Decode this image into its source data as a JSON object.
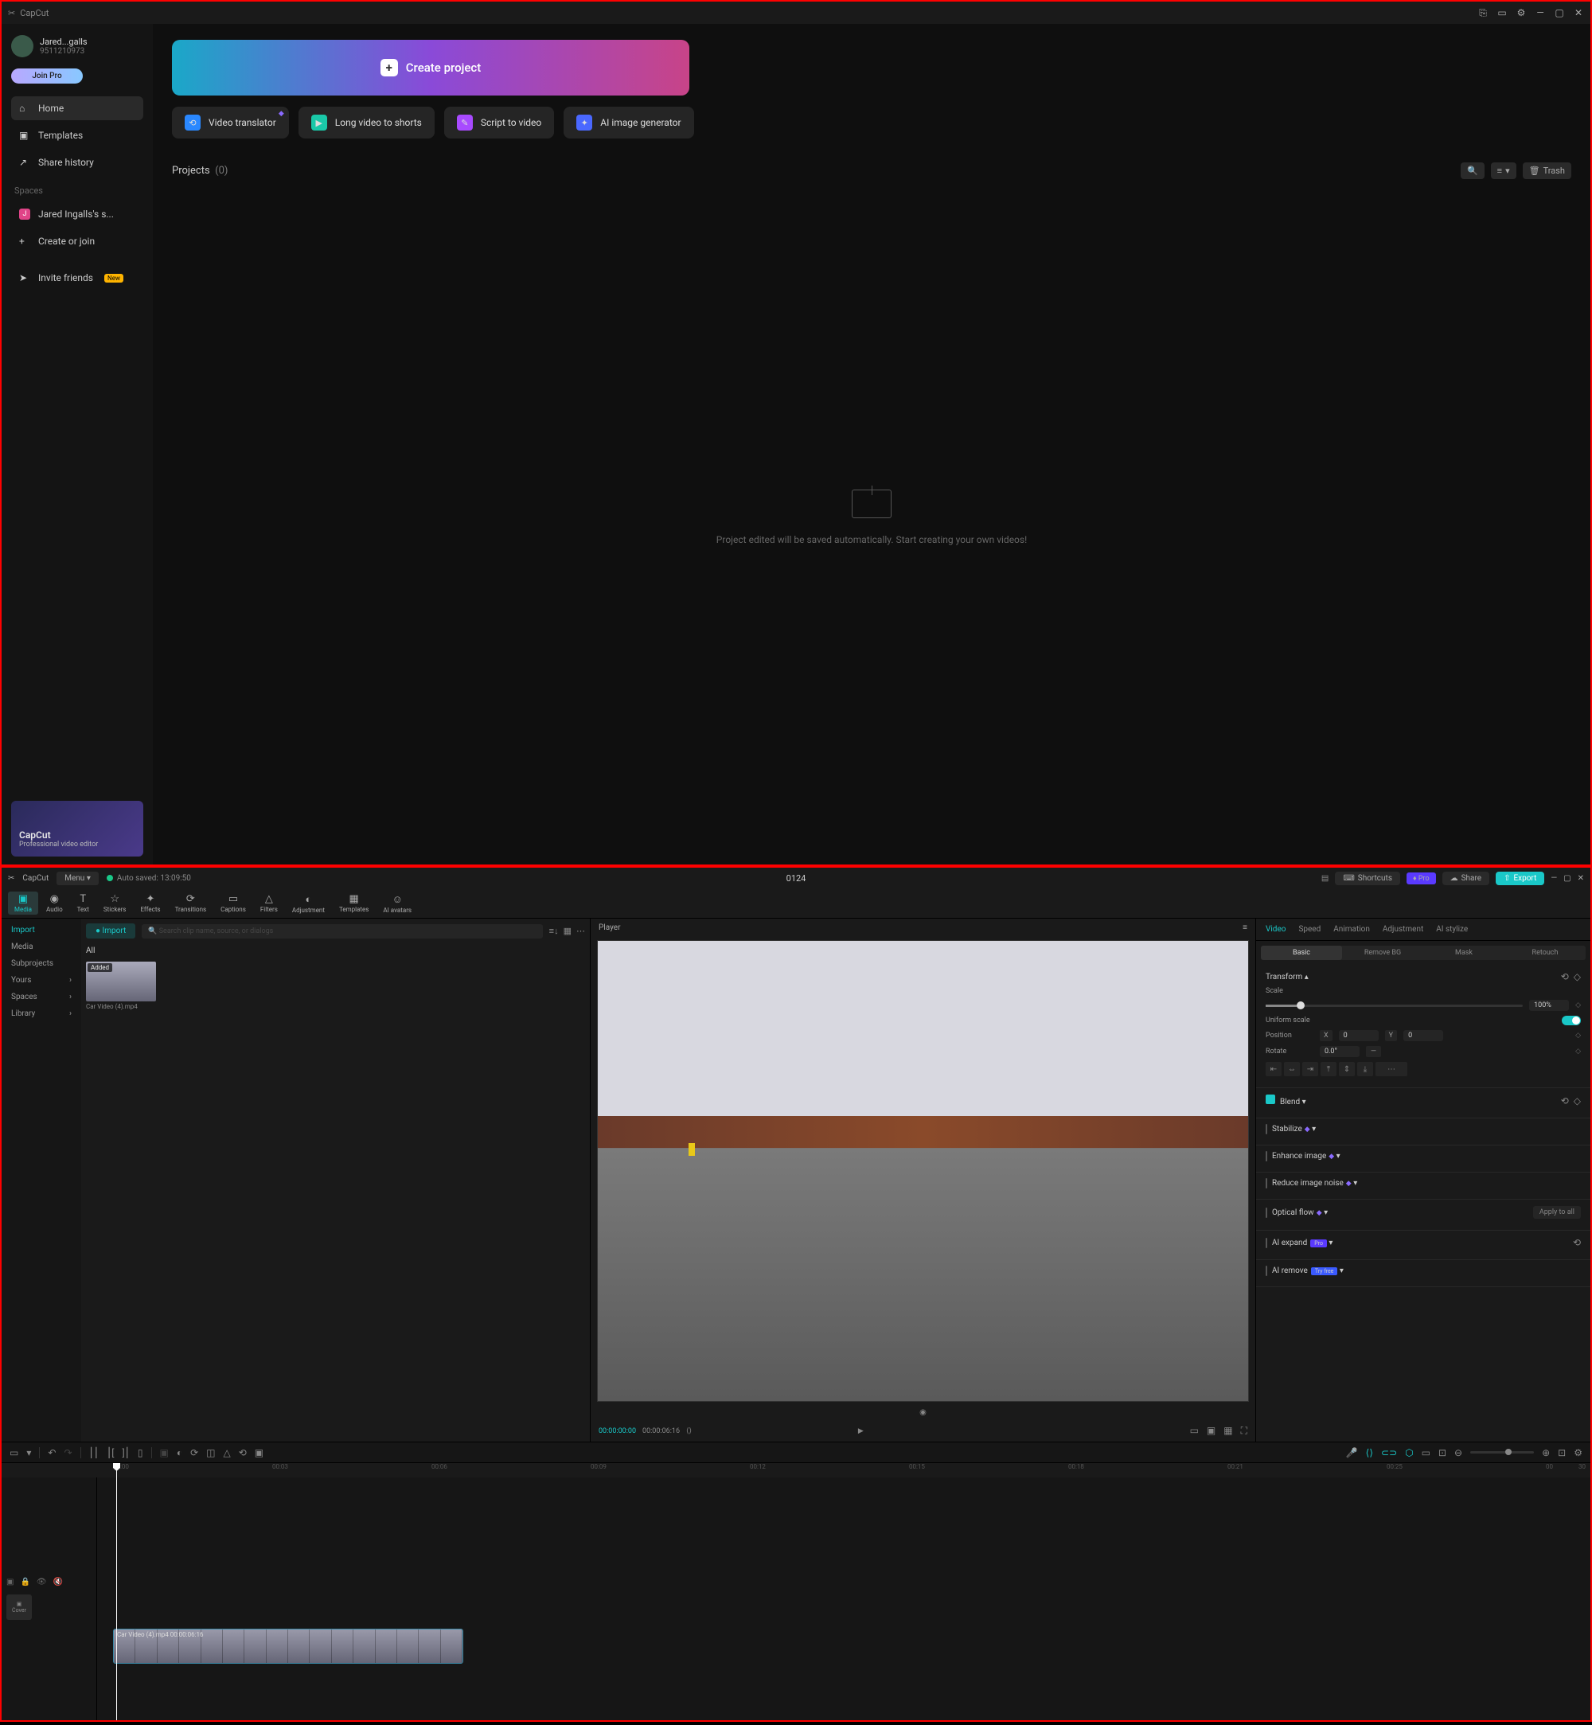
{
  "app_name": "CapCut",
  "home": {
    "user": {
      "name": "Jared...galls",
      "id": "9511210973",
      "join_pro": "Join Pro"
    },
    "nav": [
      {
        "icon": "⌂",
        "label": "Home"
      },
      {
        "icon": "▣",
        "label": "Templates"
      },
      {
        "icon": "↗",
        "label": "Share history"
      }
    ],
    "spaces_header": "Spaces",
    "spaces": [
      {
        "badge": "J",
        "label": "Jared Ingalls's s..."
      }
    ],
    "create_join": "Create or join",
    "invite": "Invite friends",
    "new_badge": "New",
    "promo": {
      "title": "CapCut",
      "sub": "Professional video editor"
    },
    "hero": "Create project",
    "quick": [
      "Video translator",
      "Long video to shorts",
      "Script to video",
      "AI image generator"
    ],
    "projects_header": "Projects",
    "projects_count": "(0)",
    "trash": "Trash",
    "empty_msg": "Project edited will be saved automatically. Start creating your own videos!"
  },
  "editor": {
    "menu": "Menu",
    "autosave": "Auto saved: 13:09:50",
    "project_name": "0124",
    "top_buttons": {
      "shortcuts": "Shortcuts",
      "pro": "Pro",
      "share": "Share",
      "export": "Export"
    },
    "tool_tabs": [
      "Media",
      "Audio",
      "Text",
      "Stickers",
      "Effects",
      "Transitions",
      "Captions",
      "Filters",
      "Adjustment",
      "Templates",
      "AI avatars"
    ],
    "left": {
      "side": [
        "Import",
        "Media",
        "Subprojects",
        "Yours",
        "Spaces",
        "Library"
      ],
      "import_btn": "Import",
      "search_placeholder": "Search clip name, source, or dialogs",
      "all_tab": "All",
      "clip": {
        "badge": "Added",
        "name": "Car Video (4).mp4"
      }
    },
    "player": {
      "header": "Player",
      "time_current": "00:00:00:00",
      "time_total": "00:00:06:16"
    },
    "right": {
      "tabs": [
        "Video",
        "Speed",
        "Animation",
        "Adjustment",
        "AI stylize"
      ],
      "subtabs": [
        "Basic",
        "Remove BG",
        "Mask",
        "Retouch"
      ],
      "transform": "Transform",
      "scale": {
        "label": "Scale",
        "value": "100%"
      },
      "uniform": "Uniform scale",
      "position": {
        "label": "Position",
        "x_label": "X",
        "x_val": "0",
        "y_label": "Y",
        "y_val": "0"
      },
      "rotate": {
        "label": "Rotate",
        "value": "0.0°"
      },
      "blend": "Blend",
      "stabilize": "Stabilize",
      "enhance": "Enhance image",
      "reduce_noise": "Reduce image noise",
      "optical": "Optical flow",
      "apply_all": "Apply to all",
      "ai_expand": "AI expand",
      "ai_expand_tag": "Pro",
      "ai_remove": "AI remove",
      "ai_remove_tag": "Try free"
    },
    "timeline": {
      "ruler": [
        "00:00",
        "00:03",
        "00:06",
        "00:09",
        "00:12",
        "00:15",
        "00:18",
        "00:21",
        "00:25",
        "00",
        "30"
      ],
      "clip_label": "Car Video (4).mp4  00:00:06:16",
      "cover": "Cover"
    }
  }
}
